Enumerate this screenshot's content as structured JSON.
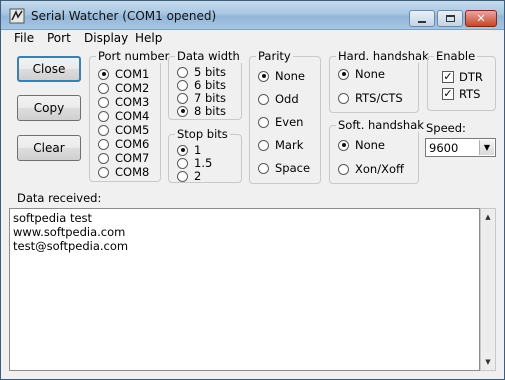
{
  "window": {
    "title": "Serial Watcher (COM1 opened)"
  },
  "menu": [
    "File",
    "Port",
    "Display",
    "Help"
  ],
  "buttons": {
    "close": "Close",
    "copy": "Copy",
    "clear": "Clear"
  },
  "port_number": {
    "title": "Port number",
    "options": [
      "COM1",
      "COM2",
      "COM3",
      "COM4",
      "COM5",
      "COM6",
      "COM7",
      "COM8"
    ],
    "selected": "COM1"
  },
  "data_width": {
    "title": "Data width",
    "options": [
      "5 bits",
      "6 bits",
      "7 bits",
      "8 bits"
    ],
    "selected": "8 bits"
  },
  "stop_bits": {
    "title": "Stop bits",
    "options": [
      "1",
      "1.5",
      "2"
    ],
    "selected": "1"
  },
  "parity": {
    "title": "Parity",
    "options": [
      "None",
      "Odd",
      "Even",
      "Mark",
      "Space"
    ],
    "selected": "None"
  },
  "hard_handshake": {
    "title": "Hard. handshak",
    "options": [
      "None",
      "RTS/CTS"
    ],
    "selected": "None"
  },
  "soft_handshake": {
    "title": "Soft. handshak",
    "options": [
      "None",
      "Xon/Xoff"
    ],
    "selected": "None"
  },
  "enable": {
    "title": "Enable",
    "options": [
      {
        "label": "DTR",
        "checked": true
      },
      {
        "label": "RTS",
        "checked": true
      }
    ]
  },
  "speed": {
    "label": "Speed:",
    "value": "9600"
  },
  "data_received": {
    "label": "Data received:",
    "lines": [
      "softpedia test",
      "www.softpedia.com",
      "test@softpedia.com"
    ]
  }
}
